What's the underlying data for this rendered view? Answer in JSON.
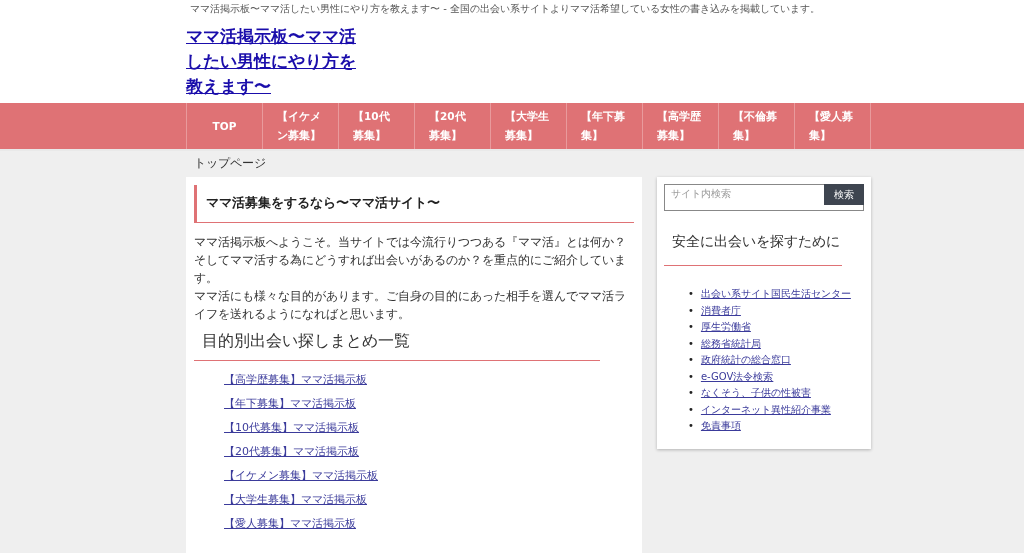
{
  "tagline": "ママ活掲示板〜ママ活したい男性にやり方を教えます〜 - 全国の出会い系サイトよりママ活希望している女性の書き込みを掲載しています。",
  "site_title": "ママ活掲示板〜ママ活したい男性にやり方を教えます〜",
  "nav": [
    {
      "label": "TOP"
    },
    {
      "label": "【イケメン募集】"
    },
    {
      "label": "【10代募集】"
    },
    {
      "label": "【20代募集】"
    },
    {
      "label": "【大学生募集】"
    },
    {
      "label": "【年下募集】"
    },
    {
      "label": "【高学歴募集】"
    },
    {
      "label": "【不倫募集】"
    },
    {
      "label": "【愛人募集】"
    }
  ],
  "breadcrumb": "トップページ",
  "article": {
    "heading": "ママ活募集をするなら〜ママ活サイト〜",
    "paragraphs": [
      "ママ活掲示板へようこそ。当サイトでは今流行りつつある『ママ活』とは何か？そしてママ活する為にどうすれば出会いがあるのか？を重点的にご紹介しています。",
      "ママ活にも様々な目的があります。ご自身の目的にあった相手を選んでママ活ライフを送れるようになればと思います。"
    ],
    "subheading": "目的別出会い探しまとめ一覧",
    "links": [
      "【高学歴募集】ママ活掲示板",
      "【年下募集】ママ活掲示板",
      "【10代募集】ママ活掲示板",
      "【20代募集】ママ活掲示板",
      "【イケメン募集】ママ活掲示板",
      "【大学生募集】ママ活掲示板",
      "【愛人募集】ママ活掲示板"
    ]
  },
  "sidebar": {
    "search": {
      "placeholder": "サイト内検索",
      "button": "検索"
    },
    "heading": "安全に出会いを探すために",
    "bullet": "•",
    "links": [
      "出会い系サイト国民生活センター",
      "消費者庁",
      "厚生労働省",
      "総務省統計局",
      "政府統計の総合窓口",
      "e-GOV法令検索",
      "なくそう、子供の性被害",
      "インターネット異性紹介事業",
      "免責事項"
    ]
  }
}
